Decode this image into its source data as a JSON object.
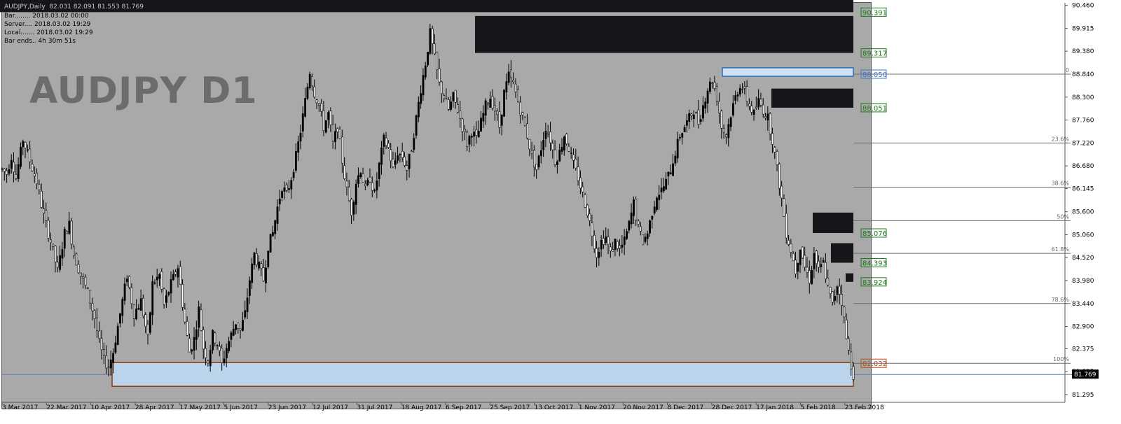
{
  "window": {
    "header_line": "AUDJPY,Daily  82.031 82.091 81.553 81.769",
    "info_lines": [
      "Bar........ 2018.03.02 00:00",
      "Server.... 2018.03.02 19:29",
      "Local....... 2018.03.02 19:29",
      "Bar ends.. 4h 30m 51s"
    ],
    "symbol_title": "AUDJPY D1"
  },
  "colors": {
    "plot_bg": "#a9a9a9",
    "zone_dark": "#16161a",
    "zone_light_fill": "#bcd3ec",
    "zone_light_border_blue": "#2a6fb8",
    "zone_light_border_brown": "#8b3a10",
    "label_green": "#1c7a1c",
    "label_blue": "#3c78c8",
    "label_brown": "#b5501c",
    "fib_line": "#6a6a6a",
    "current_price": "#5f7fa8"
  },
  "chart_data": {
    "type": "candlestick",
    "x_labels": [
      "3 Mar 2017",
      "22 Mar 2017",
      "10 Apr 2017",
      "28 Apr 2017",
      "17 May 2017",
      "5 Jun 2017",
      "23 Jun 2017",
      "12 Jul 2017",
      "31 Jul 2017",
      "18 Aug 2017",
      "6 Sep 2017",
      "25 Sep 2017",
      "13 Oct 2017",
      "1 Nov 2017",
      "20 Nov 2017",
      "8 Dec 2017",
      "28 Dec 2017",
      "17 Jan 2018",
      "5 Feb 2018",
      "23 Feb 2018"
    ],
    "y_ticks": [
      "90.460",
      "89.915",
      "89.380",
      "88.840",
      "88.300",
      "87.760",
      "87.220",
      "86.680",
      "86.145",
      "85.600",
      "85.060",
      "84.520",
      "83.980",
      "83.440",
      "82.900",
      "82.375",
      "81.835",
      "81.295"
    ],
    "y_tick_values": [
      90.46,
      89.915,
      89.38,
      88.84,
      88.3,
      87.76,
      87.22,
      86.68,
      86.145,
      85.6,
      85.06,
      84.52,
      83.98,
      83.44,
      82.9,
      82.375,
      81.835,
      81.295
    ],
    "ylim": [
      81.13,
      90.52
    ],
    "current_price": {
      "label": "81.769",
      "value": 81.769
    },
    "price_path": [
      [
        0,
        86.6
      ],
      [
        4,
        86.5
      ],
      [
        8,
        86.9
      ],
      [
        12,
        86.4
      ],
      [
        18,
        87.3
      ],
      [
        24,
        86.8
      ],
      [
        30,
        86.3
      ],
      [
        36,
        85.5
      ],
      [
        42,
        84.9
      ],
      [
        48,
        84.2
      ],
      [
        54,
        85.1
      ],
      [
        58,
        85.3
      ],
      [
        62,
        84.6
      ],
      [
        68,
        84.1
      ],
      [
        74,
        83.7
      ],
      [
        80,
        83.1
      ],
      [
        84,
        82.5
      ],
      [
        88,
        82.1
      ],
      [
        92,
        81.95
      ],
      [
        96,
        82.3
      ],
      [
        100,
        82.9
      ],
      [
        104,
        83.5
      ],
      [
        108,
        84.1
      ],
      [
        114,
        83.2
      ],
      [
        120,
        83.5
      ],
      [
        126,
        82.6
      ],
      [
        130,
        83.9
      ],
      [
        136,
        84.1
      ],
      [
        140,
        83.4
      ],
      [
        146,
        83.9
      ],
      [
        152,
        84.3
      ],
      [
        158,
        83.0
      ],
      [
        162,
        82.3
      ],
      [
        166,
        82.6
      ],
      [
        170,
        83.3
      ],
      [
        174,
        82.4
      ],
      [
        178,
        82.1
      ],
      [
        182,
        82.7
      ],
      [
        186,
        82.5
      ],
      [
        190,
        82.0
      ],
      [
        194,
        82.4
      ],
      [
        198,
        82.7
      ],
      [
        202,
        83.0
      ],
      [
        206,
        82.8
      ],
      [
        210,
        83.2
      ],
      [
        214,
        84.0
      ],
      [
        218,
        84.6
      ],
      [
        222,
        84.3
      ],
      [
        226,
        84.0
      ],
      [
        230,
        84.8
      ],
      [
        234,
        85.1
      ],
      [
        238,
        85.7
      ],
      [
        242,
        86.2
      ],
      [
        246,
        86.0
      ],
      [
        250,
        86.4
      ],
      [
        254,
        86.9
      ],
      [
        258,
        87.5
      ],
      [
        262,
        88.2
      ],
      [
        266,
        88.9
      ],
      [
        270,
        88.4
      ],
      [
        274,
        88.1
      ],
      [
        278,
        87.6
      ],
      [
        282,
        87.9
      ],
      [
        286,
        87.2
      ],
      [
        290,
        87.6
      ],
      [
        294,
        86.8
      ],
      [
        298,
        86.1
      ],
      [
        302,
        85.6
      ],
      [
        306,
        86.3
      ],
      [
        310,
        86.6
      ],
      [
        314,
        86.1
      ],
      [
        318,
        86.4
      ],
      [
        322,
        86.0
      ],
      [
        326,
        86.7
      ],
      [
        330,
        87.3
      ],
      [
        334,
        87.1
      ],
      [
        338,
        86.6
      ],
      [
        342,
        87.0
      ],
      [
        346,
        86.9
      ],
      [
        350,
        86.6
      ],
      [
        354,
        87.1
      ],
      [
        358,
        87.8
      ],
      [
        362,
        88.5
      ],
      [
        366,
        89.1
      ],
      [
        370,
        89.8
      ],
      [
        374,
        89.2
      ],
      [
        378,
        88.6
      ],
      [
        382,
        88.3
      ],
      [
        386,
        88.0
      ],
      [
        390,
        88.3
      ],
      [
        394,
        88.0
      ],
      [
        398,
        87.6
      ],
      [
        402,
        87.2
      ],
      [
        406,
        87.5
      ],
      [
        410,
        87.3
      ],
      [
        414,
        87.7
      ],
      [
        418,
        88.1
      ],
      [
        422,
        88.3
      ],
      [
        426,
        88.0
      ],
      [
        430,
        87.6
      ],
      [
        434,
        88.4
      ],
      [
        438,
        88.8
      ],
      [
        442,
        88.6
      ],
      [
        446,
        88.2
      ],
      [
        450,
        87.8
      ],
      [
        454,
        87.4
      ],
      [
        458,
        86.9
      ],
      [
        462,
        86.6
      ],
      [
        466,
        87.1
      ],
      [
        470,
        87.6
      ],
      [
        474,
        87.3
      ],
      [
        478,
        86.8
      ],
      [
        482,
        87.0
      ],
      [
        486,
        87.4
      ],
      [
        490,
        87.1
      ],
      [
        494,
        86.7
      ],
      [
        498,
        86.4
      ],
      [
        502,
        86.0
      ],
      [
        506,
        85.6
      ],
      [
        510,
        85.1
      ],
      [
        514,
        84.6
      ],
      [
        518,
        84.9
      ],
      [
        522,
        85.0
      ],
      [
        526,
        84.6
      ],
      [
        530,
        84.9
      ],
      [
        534,
        84.7
      ],
      [
        538,
        84.9
      ],
      [
        542,
        85.3
      ],
      [
        546,
        85.8
      ],
      [
        550,
        85.2
      ],
      [
        554,
        84.9
      ],
      [
        558,
        85.1
      ],
      [
        562,
        85.6
      ],
      [
        566,
        86.0
      ],
      [
        570,
        86.1
      ],
      [
        574,
        86.3
      ],
      [
        578,
        86.6
      ],
      [
        582,
        87.0
      ],
      [
        586,
        87.4
      ],
      [
        590,
        87.6
      ],
      [
        594,
        87.8
      ],
      [
        598,
        88.0
      ],
      [
        602,
        87.7
      ],
      [
        606,
        88.1
      ],
      [
        610,
        88.5
      ],
      [
        614,
        88.7
      ],
      [
        618,
        88.3
      ],
      [
        622,
        87.6
      ],
      [
        626,
        87.4
      ],
      [
        630,
        87.9
      ],
      [
        634,
        88.3
      ],
      [
        638,
        88.6
      ],
      [
        642,
        88.4
      ],
      [
        646,
        88.1
      ],
      [
        650,
        87.9
      ],
      [
        654,
        88.2
      ],
      [
        658,
        88.0
      ],
      [
        662,
        87.8
      ],
      [
        666,
        87.3
      ],
      [
        670,
        86.6
      ],
      [
        674,
        85.9
      ],
      [
        678,
        85.1
      ],
      [
        682,
        84.7
      ],
      [
        686,
        84.2
      ],
      [
        690,
        84.8
      ],
      [
        694,
        84.3
      ],
      [
        698,
        84.0
      ],
      [
        702,
        84.6
      ],
      [
        706,
        84.2
      ],
      [
        710,
        84.4
      ],
      [
        714,
        83.8
      ],
      [
        718,
        83.4
      ],
      [
        722,
        83.9
      ],
      [
        726,
        83.5
      ],
      [
        730,
        82.6
      ],
      [
        734,
        82.0
      ],
      [
        736,
        81.77
      ]
    ],
    "zones": [
      {
        "kind": "dark",
        "label": "90.391",
        "x0": 0,
        "x1": 1218,
        "p0": 90.62,
        "p1": 90.3
      },
      {
        "kind": "dark",
        "label": "89.317",
        "x0": 678,
        "x1": 1218,
        "p0": 90.21,
        "p1": 89.34
      },
      {
        "kind": "light",
        "label": "88.050",
        "x0": 1031,
        "x1": 1218,
        "p0": 88.99,
        "p1": 88.79
      },
      {
        "kind": "dark",
        "label": "88.051",
        "x0": 1101,
        "x1": 1218,
        "p0": 88.5,
        "p1": 88.05
      },
      {
        "kind": "dark",
        "label": "85.076",
        "x0": 1160,
        "x1": 1218,
        "p0": 85.58,
        "p1": 85.1
      },
      {
        "kind": "dark",
        "label": "84.393",
        "x0": 1186,
        "x1": 1218,
        "p0": 84.86,
        "p1": 84.4
      },
      {
        "kind": "dark",
        "label": "83.924",
        "x0": 1207,
        "x1": 1218,
        "p0": 84.15,
        "p1": 83.95
      },
      {
        "kind": "base",
        "label": "82.032",
        "x0": 160,
        "x1": 1218,
        "p0": 82.05,
        "p1": 81.49
      }
    ],
    "fib_levels": [
      {
        "label": "0",
        "value": 88.84
      },
      {
        "label": "23.6%",
        "value": 87.22
      },
      {
        "label": "38.6%",
        "value": 86.18
      },
      {
        "label": "50%",
        "value": 85.39
      },
      {
        "label": "61.8%",
        "value": 84.62
      },
      {
        "label": "78.6%",
        "value": 83.44
      },
      {
        "label": "100%",
        "value": 82.032
      }
    ]
  }
}
